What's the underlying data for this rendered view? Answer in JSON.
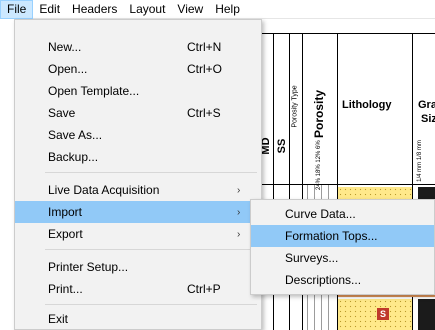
{
  "menubar": {
    "items": [
      "File",
      "Edit",
      "Headers",
      "Layout",
      "View",
      "Help"
    ]
  },
  "file_menu": {
    "items": [
      {
        "label": "New...",
        "shortcut": "Ctrl+N"
      },
      {
        "label": "Open...",
        "shortcut": "Ctrl+O"
      },
      {
        "label": "Open Template...",
        "shortcut": ""
      },
      {
        "label": "Save",
        "shortcut": "Ctrl+S"
      },
      {
        "label": "Save As...",
        "shortcut": ""
      },
      {
        "label": "Backup...",
        "shortcut": ""
      },
      {
        "label": "Live Data Acquisition",
        "shortcut": "",
        "submenu": true
      },
      {
        "label": "Import",
        "shortcut": "",
        "submenu": true,
        "highlighted": true
      },
      {
        "label": "Export",
        "shortcut": "",
        "submenu": true
      },
      {
        "label": "Printer Setup...",
        "shortcut": ""
      },
      {
        "label": "Print...",
        "shortcut": "Ctrl+P"
      },
      {
        "label": "Exit",
        "shortcut": ""
      }
    ],
    "submenu_arrow": "›"
  },
  "import_submenu": {
    "items": [
      {
        "label": "Curve Data..."
      },
      {
        "label": "Formation Tops...",
        "highlighted": true
      },
      {
        "label": "Surveys..."
      },
      {
        "label": "Descriptions..."
      }
    ]
  },
  "log_header": {
    "md": "MD",
    "ss": "SS",
    "porosity_type": "Porosity Type",
    "porosity": "Porosity",
    "porosity_ticks": "24% 18% 12% 6%",
    "lithology": "Lithology",
    "grain_size_partial": "Gra",
    "grain_size_partial2": "Siz",
    "grain_ticks": "1/4 mm 1/8 mm",
    "marker": "S"
  },
  "colors": {
    "highlight": "#91c9f7",
    "menubar_active": "#cce8ff",
    "sand": "#ffe98a",
    "marker": "#c0392b"
  }
}
